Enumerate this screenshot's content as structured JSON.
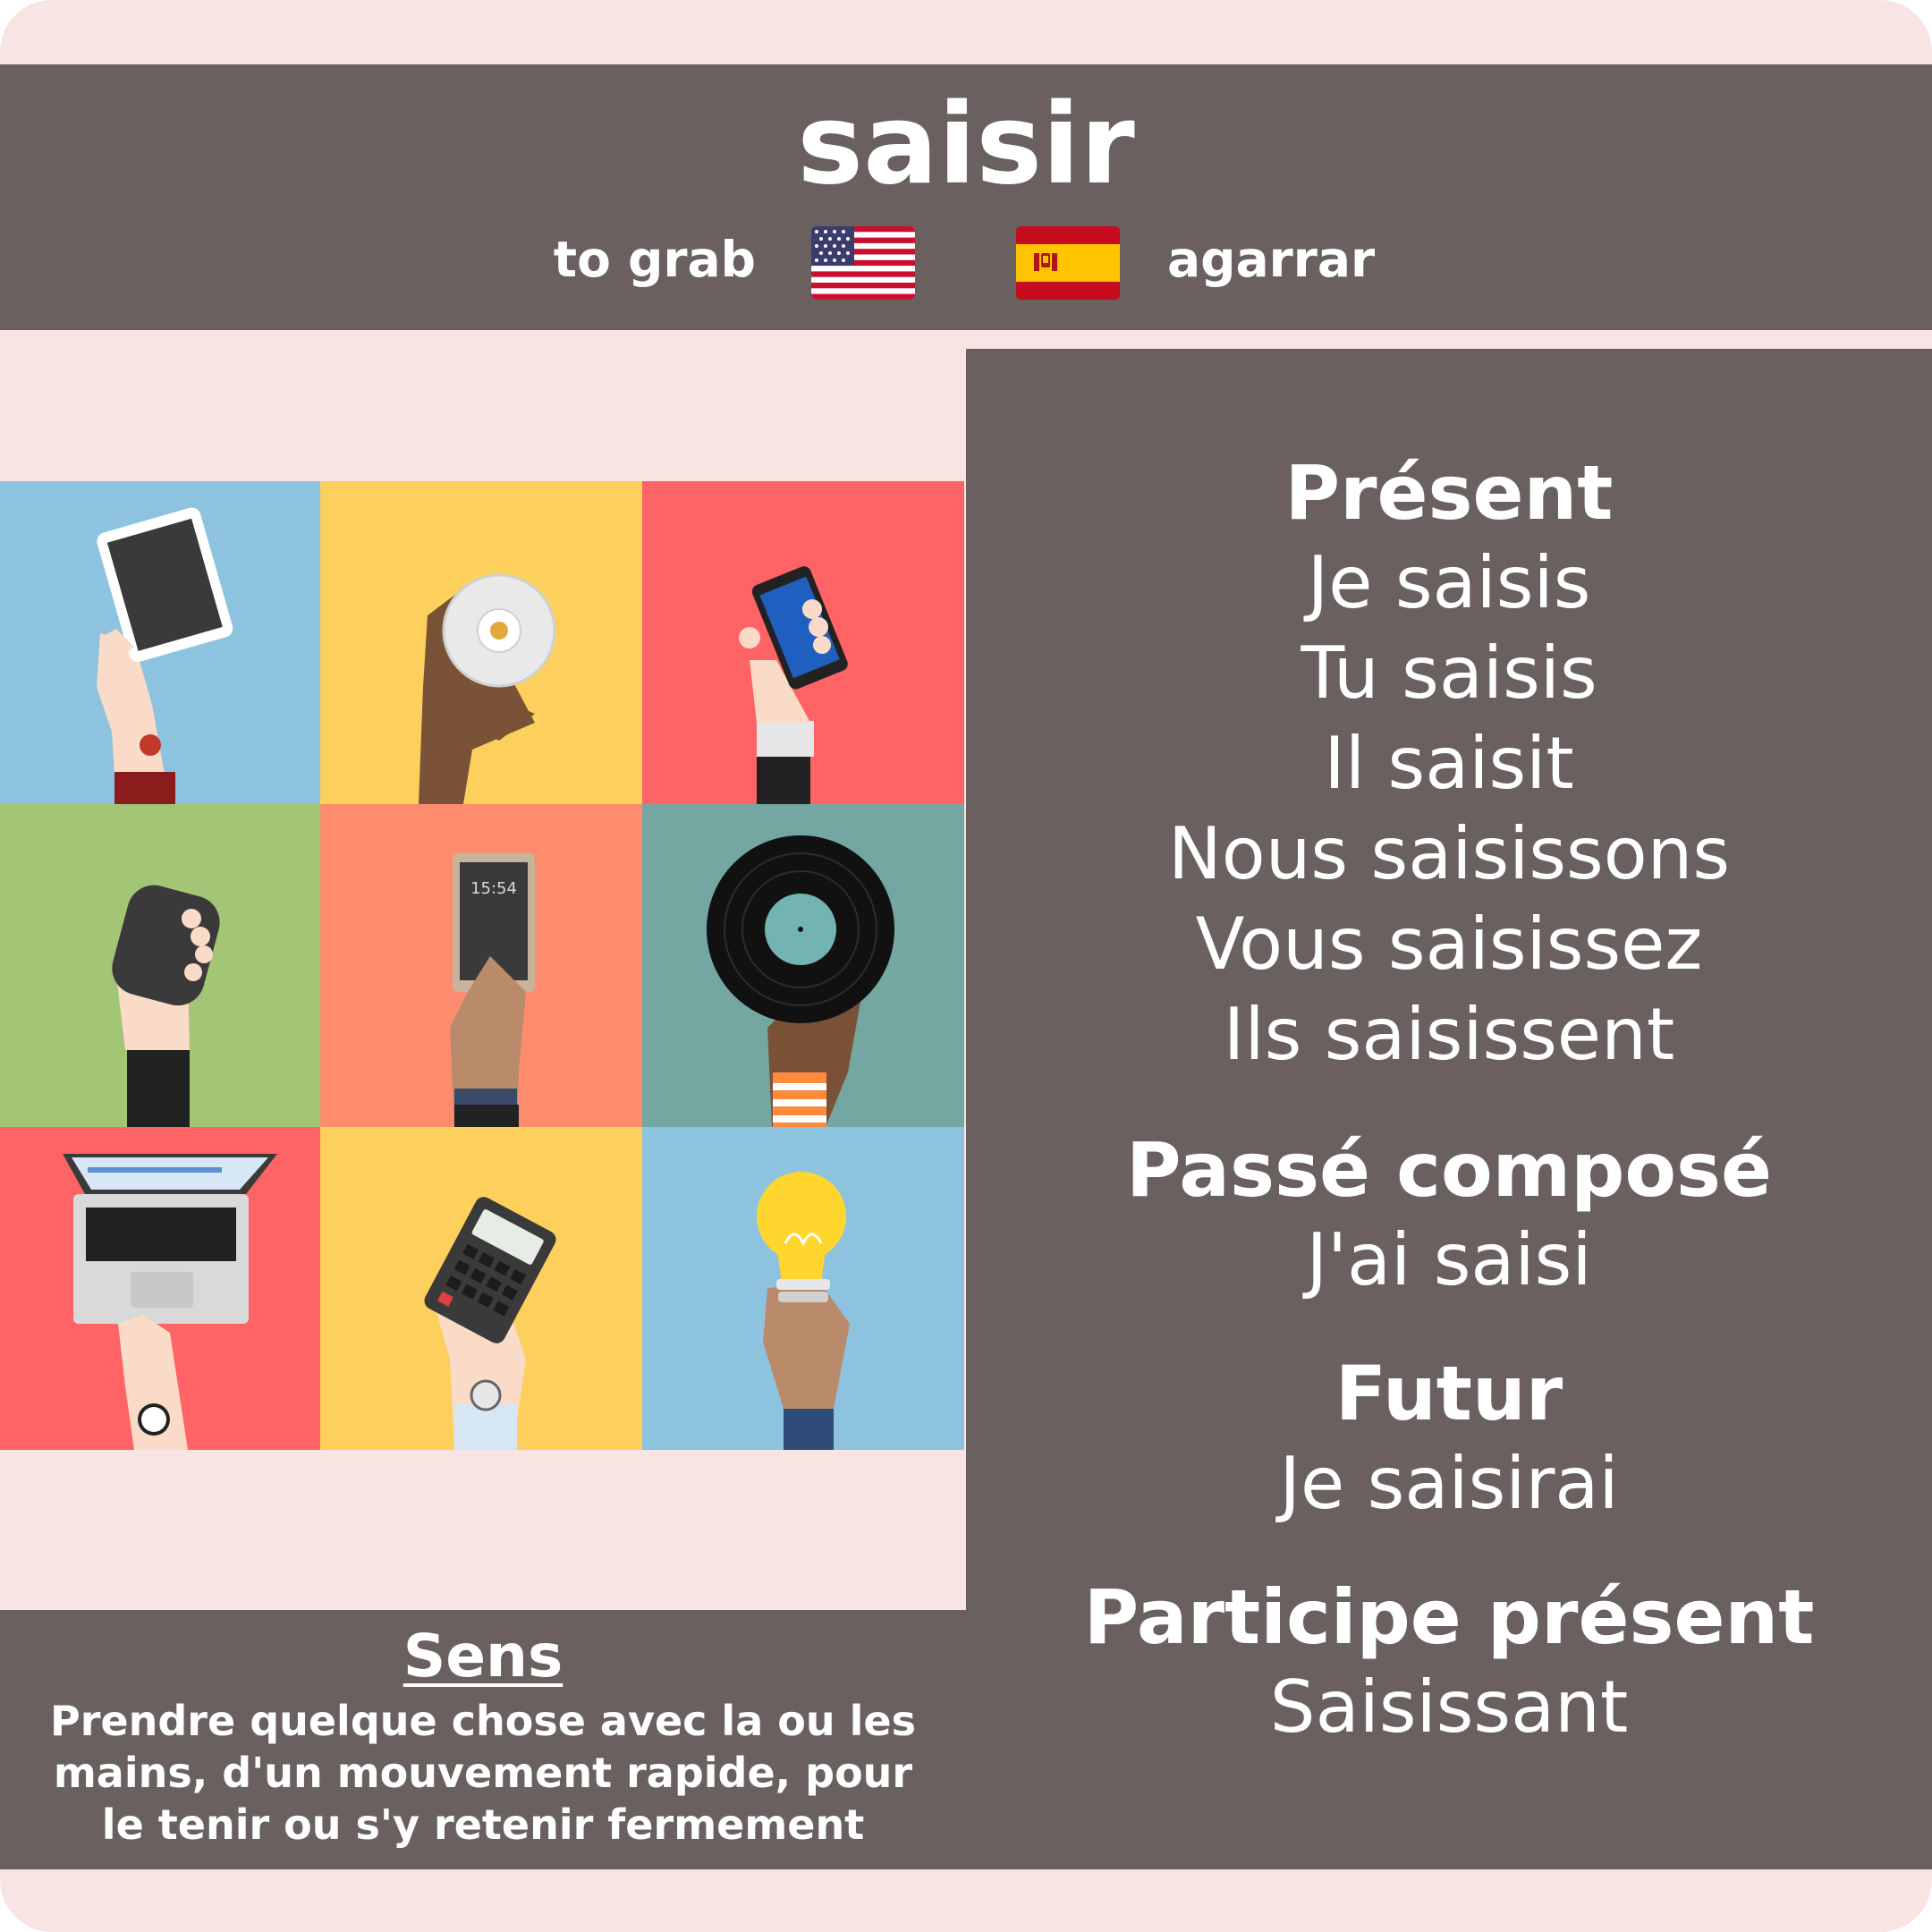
{
  "verb": "saisir",
  "translations": {
    "english": "to grab",
    "spanish": "agarrar"
  },
  "flags": {
    "english_flag_icon": "us-flag-icon",
    "spanish_flag_icon": "spain-flag-icon"
  },
  "colors": {
    "card_background": "#f9e4e4",
    "panel": "#6a6060",
    "text": "#ffffff"
  },
  "conjugation": {
    "present": {
      "heading": "Présent",
      "forms": [
        "Je saisis",
        "Tu saisis",
        "Il saisit",
        "Nous saisissons",
        "Vous saisissez",
        "Ils saisissent"
      ]
    },
    "passe_compose": {
      "heading": "Passé composé",
      "form": "J'ai saisi"
    },
    "futur": {
      "heading": "Futur",
      "form": "Je saisirai"
    },
    "participe_present": {
      "heading": "Participe présent",
      "form": "Saisissant"
    }
  },
  "illustration": {
    "tiles": [
      {
        "icon": "tablet-hand-icon",
        "color": "#8ec3df"
      },
      {
        "icon": "cd-hand-icon",
        "color": "#fdcf5c"
      },
      {
        "icon": "smartphone-hand-icon",
        "color": "#fe6365"
      },
      {
        "icon": "smartphone-back-hand-icon",
        "color": "#a3c576"
      },
      {
        "icon": "phone-clock-hand-icon",
        "color": "#fd8c6f",
        "clock": "15:54"
      },
      {
        "icon": "vinyl-record-hand-icon",
        "color": "#74a7a2"
      },
      {
        "icon": "laptop-hand-icon",
        "color": "#fe6365"
      },
      {
        "icon": "calculator-hand-icon",
        "color": "#fdcf5c"
      },
      {
        "icon": "lightbulb-hand-icon",
        "color": "#8ec3df"
      }
    ]
  },
  "meaning": {
    "title": "Sens",
    "lines": [
      "Prendre quelque chose avec la ou les",
      "mains, d'un mouvement rapide, pour",
      "le tenir ou s'y retenir fermement"
    ]
  }
}
